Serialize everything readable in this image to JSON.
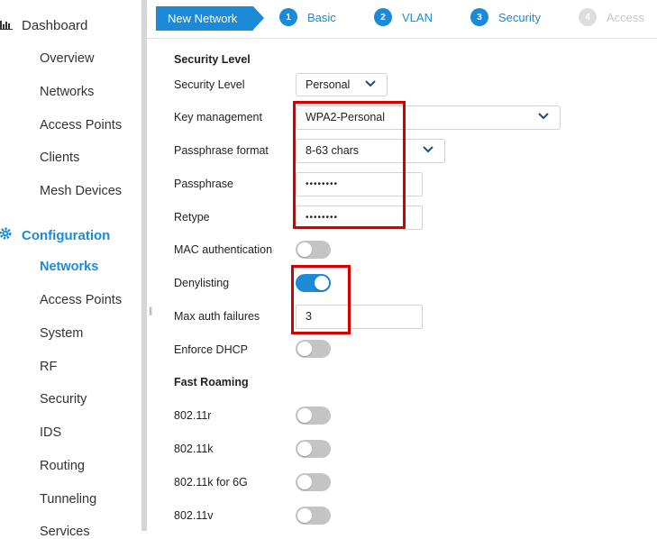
{
  "sidebar": {
    "dashboard": {
      "label": "Dashboard",
      "items": [
        "Overview",
        "Networks",
        "Access Points",
        "Clients",
        "Mesh Devices"
      ]
    },
    "configuration": {
      "label": "Configuration",
      "items": [
        "Networks",
        "Access Points",
        "System",
        "RF",
        "Security",
        "IDS",
        "Routing",
        "Tunneling",
        "Services"
      ],
      "active_item": "Networks"
    }
  },
  "wizard": {
    "current": "New Network",
    "steps": [
      {
        "num": "1",
        "label": "Basic"
      },
      {
        "num": "2",
        "label": "VLAN"
      },
      {
        "num": "3",
        "label": "Security"
      },
      {
        "num": "4",
        "label": "Access"
      }
    ]
  },
  "form": {
    "security_section": "Security Level",
    "security_level": {
      "label": "Security Level",
      "value": "Personal"
    },
    "key_management": {
      "label": "Key management",
      "value": "WPA2-Personal"
    },
    "passphrase_format": {
      "label": "Passphrase format",
      "value": "8-63 chars"
    },
    "passphrase": {
      "label": "Passphrase",
      "value": "••••••••"
    },
    "retype": {
      "label": "Retype",
      "value": "••••••••"
    },
    "mac_auth": {
      "label": "MAC authentication",
      "on": false
    },
    "denylisting": {
      "label": "Denylisting",
      "on": true
    },
    "max_auth_failures": {
      "label": "Max auth failures",
      "value": "3"
    },
    "enforce_dhcp": {
      "label": "Enforce DHCP",
      "on": false
    },
    "fast_roaming_section": "Fast Roaming",
    "r11r": {
      "label": "802.11r",
      "on": false
    },
    "r11k": {
      "label": "802.11k",
      "on": false
    },
    "r11k6g": {
      "label": "802.11k for 6G",
      "on": false
    },
    "r11v": {
      "label": "802.11v",
      "on": false
    }
  },
  "colors": {
    "accent": "#1c8ad6",
    "highlight": "#d40000"
  }
}
